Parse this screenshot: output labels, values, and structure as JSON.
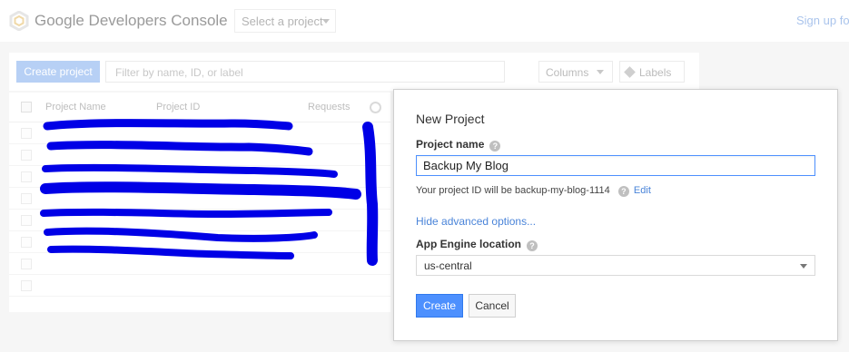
{
  "app": {
    "brand": "Google Developers Console",
    "project_select_label": "Select a project",
    "signup_label": "Sign up for",
    "logo_icon": "hexagon-logo-icon"
  },
  "toolbar": {
    "create_project_label": "Create project",
    "filter_placeholder": "Filter by name, ID, or label",
    "columns_label": "Columns",
    "labels_label": "Labels"
  },
  "table": {
    "headers": [
      "Project Name",
      "Project ID",
      "Requests"
    ],
    "rows_redacted": true
  },
  "modal": {
    "title": "New Project",
    "project_name_label": "Project name",
    "project_name_value": "Backup My Blog",
    "project_id_text": "Your project ID will be backup-my-blog-1114",
    "edit_label": "Edit",
    "advanced_link": "Hide advanced options...",
    "location_label": "App Engine location",
    "location_value": "us-central",
    "create_label": "Create",
    "cancel_label": "Cancel",
    "help_glyph": "?"
  },
  "colors": {
    "accent": "#4d90fe",
    "link": "#4a84d9",
    "redaction": "#0000e6"
  }
}
